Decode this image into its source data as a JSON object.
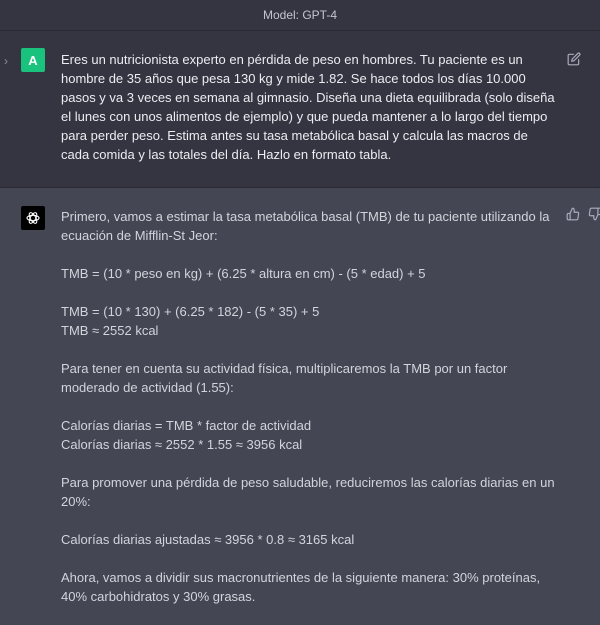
{
  "header": {
    "model_label": "Model: GPT-4"
  },
  "user": {
    "avatar_letter": "A",
    "message": "Eres un nutricionista experto en pérdida de peso en hombres. Tu paciente es un hombre de 35 años que pesa 130 kg y mide 1.82. Se hace todos los días 10.000 pasos y va 3 veces en semana al gimnasio. Diseña una dieta equilibrada (solo diseña el lunes con unos alimentos de ejemplo) y que pueda mantener a lo largo del tiempo para perder peso. Estima antes su tasa metabólica basal y calcula las macros de cada comida y las totales del día. Hazlo en formato tabla."
  },
  "assistant": {
    "paragraphs": [
      "Primero, vamos a estimar la tasa metabólica basal (TMB) de tu paciente utilizando la ecuación de Mifflin-St Jeor:",
      "TMB = (10 * peso en kg) + (6.25 * altura en cm) - (5 * edad) + 5",
      "TMB = (10 * 130) + (6.25 * 182) - (5 * 35) + 5",
      "TMB ≈ 2552 kcal",
      "Para tener en cuenta su actividad física, multiplicaremos la TMB por un factor moderado de actividad (1.55):",
      "Calorías diarias = TMB * factor de actividad",
      "Calorías diarias ≈ 2552 * 1.55 ≈ 3956 kcal",
      "Para promover una pérdida de peso saludable, reduciremos las calorías diarias en un 20%:",
      "Calorías diarias ajustadas ≈ 3956 * 0.8 ≈ 3165 kcal",
      "Ahora, vamos a dividir sus macronutrientes de la siguiente manera: 30% proteínas, 40% carbohidratos y 30% grasas."
    ]
  },
  "icons": {
    "edit": "edit-icon",
    "thumb_up": "thumb-up-icon",
    "thumb_down": "thumb-down-icon",
    "openai_logo": "openai-logo-icon",
    "chevron": "chevron-right-icon"
  },
  "colors": {
    "user_bg": "#343541",
    "assistant_bg": "#444654",
    "user_avatar": "#19c37d"
  }
}
